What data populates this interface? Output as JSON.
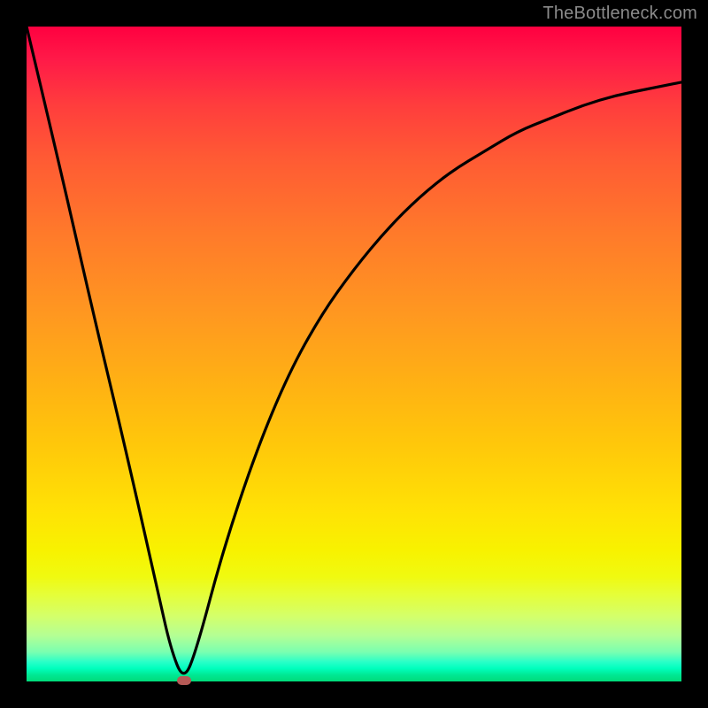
{
  "watermark": "TheBottleneck.com",
  "chart_data": {
    "type": "line",
    "title": "",
    "xlabel": "",
    "ylabel": "",
    "xlim": [
      0,
      100
    ],
    "ylim": [
      0,
      100
    ],
    "grid": false,
    "legend": false,
    "series": [
      {
        "name": "bottleneck-curve",
        "x": [
          0,
          5,
          10,
          15,
          20,
          22,
          24,
          26,
          30,
          35,
          40,
          45,
          50,
          55,
          60,
          65,
          70,
          75,
          80,
          85,
          90,
          95,
          100
        ],
        "y": [
          100,
          79,
          57,
          36,
          14,
          5,
          0,
          5,
          20,
          35,
          47,
          56,
          63,
          69,
          74,
          78,
          81,
          84,
          86,
          88,
          89.5,
          90.5,
          91.5
        ]
      }
    ],
    "optimum_marker": {
      "x": 24,
      "y": 0,
      "color_name": "muted-red"
    },
    "background_gradient": {
      "top": "#ff0040",
      "mid": "#ffd200",
      "bottom": "#00db7a"
    },
    "colors": {
      "curve": "#000000",
      "marker": "#b55a56",
      "frame": "#000000"
    }
  }
}
